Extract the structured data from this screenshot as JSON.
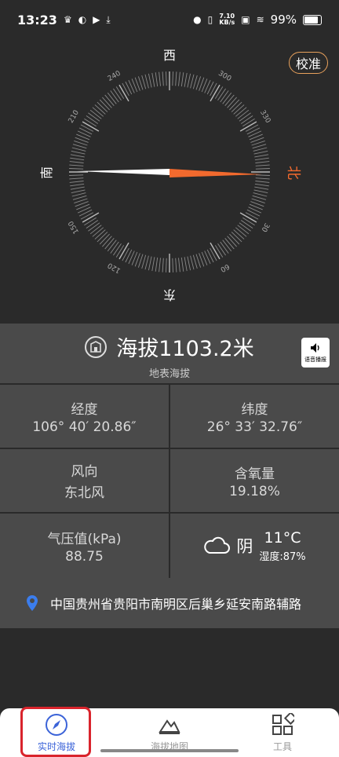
{
  "status_bar": {
    "time": "13:23",
    "network_speed_value": "7.10",
    "network_speed_unit": "KB/s",
    "battery": "99%"
  },
  "compass": {
    "directions": {
      "north": "北",
      "south": "南",
      "east": "东",
      "west": "西"
    },
    "degree_labels": [
      "30",
      "60",
      "120",
      "150",
      "210",
      "240",
      "300",
      "330"
    ],
    "needle_bearing_deg": 0,
    "calibrate_label": "校准",
    "accent_color": "#f26a2e"
  },
  "altitude": {
    "value_text": "海拔1103.2米",
    "subtitle": "地表海拔",
    "voice_label": "语音播报"
  },
  "info": {
    "longitude": {
      "label": "经度",
      "value": "106° 40′ 20.86″"
    },
    "latitude": {
      "label": "纬度",
      "value": "26° 33′ 32.76″"
    },
    "wind": {
      "label": "风向",
      "value": "东北风"
    },
    "oxygen": {
      "label": "含氧量",
      "value": "19.18%"
    },
    "pressure": {
      "label": "气压值(kPa)",
      "value": "88.75"
    },
    "weather": {
      "condition": "阴",
      "temperature": "11°C",
      "humidity": "湿度:87%"
    }
  },
  "address": {
    "text": "中国贵州省贵阳市南明区后巢乡延安南路辅路"
  },
  "nav": {
    "items": [
      {
        "label": "实时海拔",
        "icon": "compass-icon",
        "active": true
      },
      {
        "label": "海拔地图",
        "icon": "mountain-icon",
        "active": false
      },
      {
        "label": "工具",
        "icon": "tools-grid-icon",
        "active": false
      }
    ],
    "active_color": "#3b63d8"
  }
}
